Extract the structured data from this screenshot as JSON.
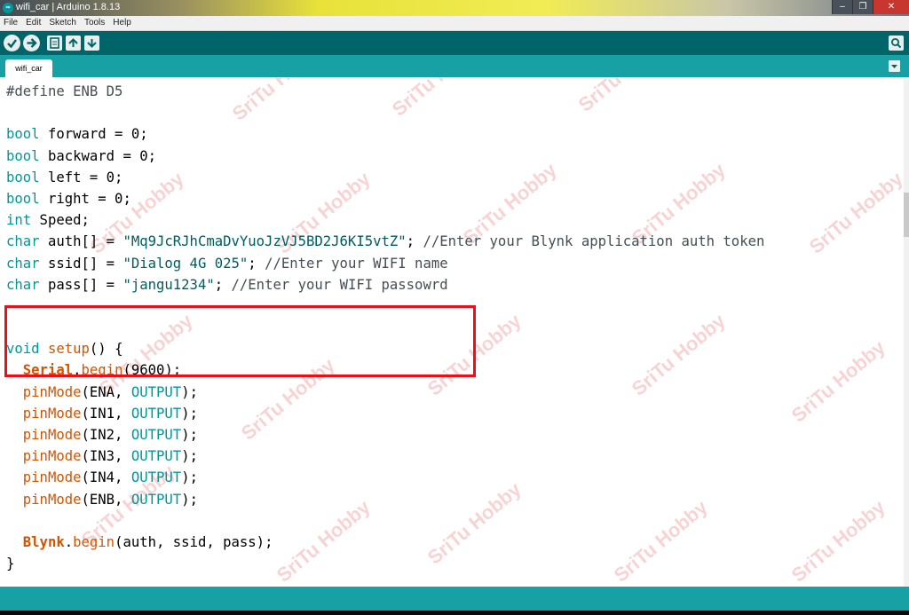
{
  "window": {
    "title": "wifi_car | Arduino 1.8.13",
    "app_icon_label": "∞"
  },
  "menu": [
    "File",
    "Edit",
    "Sketch",
    "Tools",
    "Help"
  ],
  "toolbar": {
    "buttons": [
      "verify-icon",
      "upload-icon",
      "new-icon",
      "open-icon",
      "save-icon",
      "serial-monitor-icon"
    ]
  },
  "tabs": [
    {
      "label": "wifi_car"
    }
  ],
  "editor": {
    "lines": [
      [
        {
          "t": "#define ENB D5",
          "c": "pp"
        }
      ],
      [],
      [
        {
          "t": "bool",
          "c": "kw"
        },
        {
          "t": " forward = 0;"
        }
      ],
      [
        {
          "t": "bool",
          "c": "kw"
        },
        {
          "t": " backward = 0;"
        }
      ],
      [
        {
          "t": "bool",
          "c": "kw"
        },
        {
          "t": " left = 0;"
        }
      ],
      [
        {
          "t": "bool",
          "c": "kw"
        },
        {
          "t": " right = 0;"
        }
      ],
      [
        {
          "t": "int",
          "c": "kw"
        },
        {
          "t": " Speed;"
        }
      ],
      [
        {
          "t": "char",
          "c": "kw"
        },
        {
          "t": " auth[] = "
        },
        {
          "t": "\"Mq9JcRJhCmaDvYuoJzVJ5BD2J6KI5vtZ\"",
          "c": "str"
        },
        {
          "t": "; "
        },
        {
          "t": "//Enter your Blynk application auth token",
          "c": "cm"
        }
      ],
      [
        {
          "t": "char",
          "c": "kw"
        },
        {
          "t": " ssid[] = "
        },
        {
          "t": "\"Dialog 4G 025\"",
          "c": "str"
        },
        {
          "t": "; "
        },
        {
          "t": "//Enter your WIFI name",
          "c": "cm"
        }
      ],
      [
        {
          "t": "char",
          "c": "kw"
        },
        {
          "t": " pass[] = "
        },
        {
          "t": "\"jangu1234\"",
          "c": "str"
        },
        {
          "t": "; "
        },
        {
          "t": "//Enter your WIFI passowrd",
          "c": "cm"
        }
      ],
      [],
      [],
      [
        {
          "t": "void",
          "c": "kw"
        },
        {
          "t": " "
        },
        {
          "t": "setup",
          "c": "fn"
        },
        {
          "t": "() {"
        }
      ],
      [
        {
          "t": "  "
        },
        {
          "t": "Serial",
          "c": "cls"
        },
        {
          "t": "."
        },
        {
          "t": "begin",
          "c": "fn"
        },
        {
          "t": "(9600);"
        }
      ],
      [
        {
          "t": "  "
        },
        {
          "t": "pinMode",
          "c": "fn"
        },
        {
          "t": "(ENA, "
        },
        {
          "t": "OUTPUT",
          "c": "cst"
        },
        {
          "t": ");"
        }
      ],
      [
        {
          "t": "  "
        },
        {
          "t": "pinMode",
          "c": "fn"
        },
        {
          "t": "(IN1, "
        },
        {
          "t": "OUTPUT",
          "c": "cst"
        },
        {
          "t": ");"
        }
      ],
      [
        {
          "t": "  "
        },
        {
          "t": "pinMode",
          "c": "fn"
        },
        {
          "t": "(IN2, "
        },
        {
          "t": "OUTPUT",
          "c": "cst"
        },
        {
          "t": ");"
        }
      ],
      [
        {
          "t": "  "
        },
        {
          "t": "pinMode",
          "c": "fn"
        },
        {
          "t": "(IN3, "
        },
        {
          "t": "OUTPUT",
          "c": "cst"
        },
        {
          "t": ");"
        }
      ],
      [
        {
          "t": "  "
        },
        {
          "t": "pinMode",
          "c": "fn"
        },
        {
          "t": "(IN4, "
        },
        {
          "t": "OUTPUT",
          "c": "cst"
        },
        {
          "t": ");"
        }
      ],
      [
        {
          "t": "  "
        },
        {
          "t": "pinMode",
          "c": "fn"
        },
        {
          "t": "(ENB, "
        },
        {
          "t": "OUTPUT",
          "c": "cst"
        },
        {
          "t": ");"
        }
      ],
      [],
      [
        {
          "t": "  "
        },
        {
          "t": "Blynk",
          "c": "cls"
        },
        {
          "t": "."
        },
        {
          "t": "begin",
          "c": "fn"
        },
        {
          "t": "(auth, ssid, pass);"
        }
      ],
      [
        {
          "t": "}"
        }
      ]
    ]
  },
  "watermark": {
    "text": "SriTu Hobby"
  },
  "colors": {
    "toolbar": "#006468",
    "tabbar": "#17a1a5",
    "keyword": "#00979c",
    "function": "#d35400",
    "highlight_box": "#e8111a"
  }
}
